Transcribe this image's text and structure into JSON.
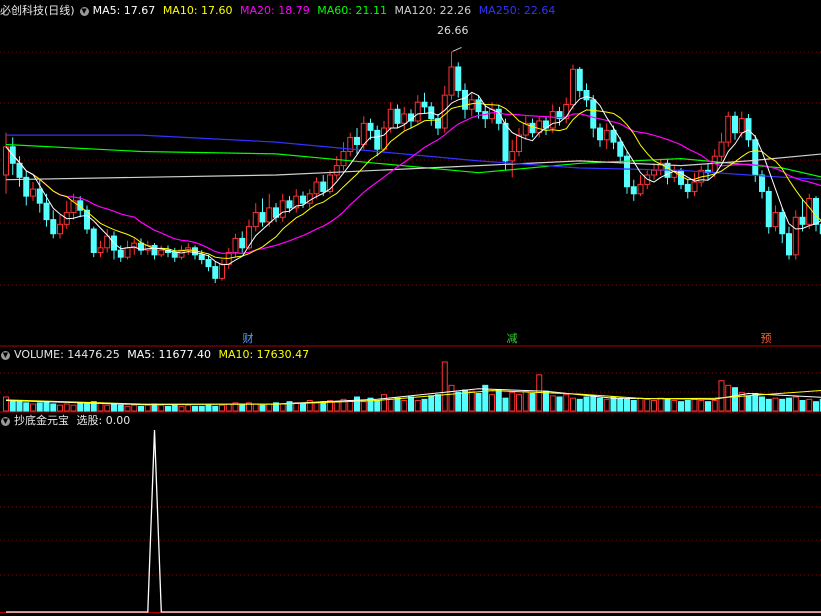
{
  "colors": {
    "up": "#ff3232",
    "down": "#54ffff",
    "ma5": "#ffffff",
    "ma10": "#ffff00",
    "ma20": "#ff00ff",
    "ma60": "#00ff00",
    "ma120": "#d0d0d0",
    "ma250": "#3232ff",
    "grid": "#8a0000",
    "sep": "#b00000",
    "axis": "#c00000"
  },
  "icons": {
    "menu": "circle-down-icon"
  },
  "price_panel": {
    "stock": "必创科技(日线)",
    "ma5": "MA5: 17.67",
    "ma10": "MA10: 17.60",
    "ma20": "MA20: 18.79",
    "ma60": "MA60: 21.11",
    "ma120": "MA120: 22.26",
    "ma250": "MA250: 22.64",
    "high_label": "26.66"
  },
  "markers": [
    {
      "text": "财",
      "color": "#54a0ff"
    },
    {
      "text": "减",
      "color": "#30d030"
    },
    {
      "text": "预",
      "color": "#ff6030"
    }
  ],
  "volume_panel": {
    "vol": "VOLUME: 14476.25",
    "ma5": "MA5: 11677.40",
    "ma10": "MA10: 17630.47"
  },
  "indicator_panel": {
    "name": "抄底金元宝",
    "value": "选股: 0.00"
  },
  "chart_data": [
    {
      "type": "candlestick",
      "title": "必创科技(日线)",
      "ylim": [
        14.8,
        28.0
      ],
      "annotations": [
        "26.66"
      ],
      "candles": [
        [
          21.4,
          22.6,
          20.6,
          23.2
        ],
        [
          22.6,
          21.9,
          21.4,
          23.0
        ],
        [
          21.9,
          21.3,
          20.9,
          22.2
        ],
        [
          21.3,
          20.5,
          20.1,
          21.6
        ],
        [
          20.5,
          20.8,
          20.3,
          21.1
        ],
        [
          20.8,
          20.2,
          19.8,
          21.2
        ],
        [
          20.2,
          19.5,
          19.2,
          20.6
        ],
        [
          19.5,
          18.9,
          18.7,
          19.9
        ],
        [
          18.9,
          19.3,
          18.7,
          19.7
        ],
        [
          19.3,
          19.8,
          19.1,
          20.3
        ],
        [
          19.8,
          20.3,
          19.5,
          20.6
        ],
        [
          20.3,
          19.9,
          19.6,
          20.5
        ],
        [
          19.9,
          19.1,
          18.9,
          20.1
        ],
        [
          19.1,
          18.1,
          17.9,
          19.2
        ],
        [
          18.1,
          18.3,
          17.9,
          18.6
        ],
        [
          18.3,
          18.8,
          18.1,
          19.1
        ],
        [
          18.8,
          18.2,
          17.8,
          19.0
        ],
        [
          18.2,
          17.9,
          17.7,
          18.4
        ],
        [
          17.9,
          18.3,
          17.8,
          18.6
        ],
        [
          18.3,
          18.5,
          18.0,
          18.7
        ],
        [
          18.5,
          18.2,
          18.0,
          18.7
        ],
        [
          18.2,
          18.4,
          18.0,
          18.6
        ],
        [
          18.4,
          18.0,
          17.8,
          18.5
        ],
        [
          18.0,
          18.2,
          17.9,
          18.4
        ],
        [
          18.2,
          18.1,
          17.9,
          18.4
        ],
        [
          18.1,
          17.9,
          17.7,
          18.3
        ],
        [
          17.9,
          18.2,
          17.8,
          18.4
        ],
        [
          18.2,
          18.3,
          18.0,
          18.5
        ],
        [
          18.3,
          18.0,
          17.8,
          18.4
        ],
        [
          18.0,
          17.8,
          17.6,
          18.2
        ],
        [
          17.8,
          17.5,
          17.3,
          18.0
        ],
        [
          17.5,
          17.0,
          16.8,
          17.7
        ],
        [
          17.0,
          17.6,
          16.9,
          17.8
        ],
        [
          17.6,
          18.1,
          17.4,
          18.3
        ],
        [
          18.1,
          18.7,
          17.9,
          18.9
        ],
        [
          18.7,
          18.3,
          18.1,
          19.0
        ],
        [
          18.3,
          19.2,
          18.2,
          19.5
        ],
        [
          19.2,
          19.8,
          19.0,
          20.2
        ],
        [
          19.8,
          19.4,
          19.2,
          20.4
        ],
        [
          19.4,
          20.0,
          19.2,
          20.6
        ],
        [
          20.0,
          19.6,
          19.4,
          20.2
        ],
        [
          19.6,
          20.3,
          19.4,
          20.6
        ],
        [
          20.3,
          20.0,
          19.8,
          20.5
        ],
        [
          20.0,
          20.5,
          19.8,
          20.8
        ],
        [
          20.5,
          20.2,
          20.0,
          20.7
        ],
        [
          20.2,
          20.6,
          20.0,
          20.8
        ],
        [
          20.6,
          21.1,
          20.4,
          21.3
        ],
        [
          21.1,
          20.7,
          20.5,
          21.4
        ],
        [
          20.7,
          21.4,
          20.6,
          21.6
        ],
        [
          21.4,
          21.8,
          21.2,
          22.2
        ],
        [
          21.8,
          22.4,
          21.6,
          22.8
        ],
        [
          22.4,
          23.0,
          22.2,
          23.2
        ],
        [
          23.0,
          22.7,
          22.3,
          23.4
        ],
        [
          22.7,
          23.6,
          22.5,
          23.9
        ],
        [
          23.6,
          23.3,
          22.9,
          23.8
        ],
        [
          23.3,
          22.5,
          22.2,
          23.5
        ],
        [
          22.5,
          23.4,
          22.4,
          23.7
        ],
        [
          23.4,
          24.2,
          23.2,
          24.5
        ],
        [
          24.2,
          23.6,
          23.4,
          24.4
        ],
        [
          23.6,
          24.0,
          23.3,
          24.3
        ],
        [
          24.0,
          23.7,
          23.4,
          24.2
        ],
        [
          23.7,
          24.5,
          23.6,
          24.8
        ],
        [
          24.5,
          24.3,
          24.0,
          24.9
        ],
        [
          24.3,
          23.8,
          23.5,
          24.5
        ],
        [
          23.8,
          23.4,
          23.1,
          24.0
        ],
        [
          23.4,
          24.8,
          23.2,
          25.2
        ],
        [
          24.8,
          26.0,
          24.6,
          26.66
        ],
        [
          26.0,
          25.0,
          24.7,
          26.2
        ],
        [
          25.0,
          24.2,
          23.8,
          25.3
        ],
        [
          24.2,
          24.6,
          23.9,
          24.9
        ],
        [
          24.6,
          24.1,
          23.8,
          24.8
        ],
        [
          24.1,
          23.8,
          23.4,
          24.4
        ],
        [
          23.8,
          24.2,
          23.6,
          24.5
        ],
        [
          24.2,
          23.6,
          23.3,
          24.4
        ],
        [
          23.6,
          22.0,
          21.6,
          23.8
        ],
        [
          22.0,
          22.4,
          21.3,
          22.9
        ],
        [
          22.4,
          23.1,
          22.2,
          23.4
        ],
        [
          23.1,
          23.6,
          22.9,
          23.9
        ],
        [
          23.6,
          23.2,
          23.0,
          23.8
        ],
        [
          23.2,
          23.7,
          23.0,
          23.9
        ],
        [
          23.7,
          23.4,
          23.1,
          23.9
        ],
        [
          23.4,
          24.1,
          23.2,
          24.4
        ],
        [
          24.1,
          23.8,
          23.5,
          24.3
        ],
        [
          23.8,
          24.4,
          23.6,
          24.7
        ],
        [
          24.4,
          25.9,
          24.2,
          26.1
        ],
        [
          25.9,
          25.0,
          24.7,
          26.0
        ],
        [
          25.0,
          24.6,
          24.3,
          25.3
        ],
        [
          24.6,
          23.4,
          23.0,
          24.8
        ],
        [
          23.4,
          22.9,
          22.6,
          23.6
        ],
        [
          22.9,
          23.3,
          22.5,
          23.6
        ],
        [
          23.3,
          22.8,
          22.5,
          23.5
        ],
        [
          22.8,
          22.2,
          21.9,
          23.0
        ],
        [
          22.2,
          20.9,
          20.6,
          22.4
        ],
        [
          20.9,
          20.6,
          20.3,
          21.2
        ],
        [
          20.6,
          21.0,
          20.5,
          21.4
        ],
        [
          21.0,
          21.4,
          20.8,
          21.6
        ],
        [
          21.4,
          21.6,
          21.2,
          21.9
        ],
        [
          21.6,
          21.9,
          21.4,
          22.1
        ],
        [
          21.9,
          21.3,
          21.0,
          22.1
        ],
        [
          21.3,
          21.6,
          21.1,
          21.8
        ],
        [
          21.6,
          21.0,
          20.8,
          21.7
        ],
        [
          21.0,
          20.7,
          20.4,
          21.2
        ],
        [
          20.7,
          21.1,
          20.5,
          21.5
        ],
        [
          21.1,
          21.6,
          20.9,
          21.8
        ],
        [
          21.6,
          21.5,
          21.2,
          21.9
        ],
        [
          21.5,
          22.2,
          21.3,
          22.5
        ],
        [
          22.2,
          22.8,
          22.0,
          23.2
        ],
        [
          22.8,
          23.9,
          22.6,
          24.1
        ],
        [
          23.9,
          23.2,
          22.9,
          24.1
        ],
        [
          23.2,
          23.8,
          23.0,
          24.1
        ],
        [
          23.8,
          22.9,
          22.6,
          24.0
        ],
        [
          22.9,
          21.4,
          21.1,
          23.1
        ],
        [
          21.4,
          20.7,
          20.4,
          21.6
        ],
        [
          20.7,
          19.2,
          18.9,
          20.9
        ],
        [
          19.2,
          19.8,
          19.0,
          20.1
        ],
        [
          19.8,
          18.9,
          18.5,
          20.0
        ],
        [
          18.9,
          18.0,
          17.8,
          19.2
        ],
        [
          18.0,
          19.6,
          17.8,
          19.9
        ],
        [
          19.6,
          19.3,
          19.0,
          20.4
        ],
        [
          19.3,
          20.4,
          19.1,
          20.6
        ],
        [
          20.4,
          19.3,
          19.0,
          20.5
        ],
        [
          19.3,
          18.9,
          18.7,
          19.5
        ]
      ],
      "ma_lines": [
        {
          "name": "MA60",
          "values": [
            [
              0,
              22.7
            ],
            [
              20,
              22.4
            ],
            [
              40,
              22.3
            ],
            [
              55,
              21.9
            ],
            [
              70,
              21.5
            ],
            [
              85,
              21.9
            ],
            [
              100,
              22.1
            ],
            [
              115,
              21.7
            ],
            [
              121,
              21.3
            ]
          ]
        },
        {
          "name": "MA120",
          "values": [
            [
              0,
              21.2
            ],
            [
              20,
              21.3
            ],
            [
              40,
              21.4
            ],
            [
              55,
              21.6
            ],
            [
              70,
              21.8
            ],
            [
              85,
              22.0
            ],
            [
              100,
              21.8
            ],
            [
              110,
              22.0
            ],
            [
              121,
              22.3
            ]
          ]
        },
        {
          "name": "MA250",
          "values": [
            [
              0,
              23.1
            ],
            [
              20,
              23.1
            ],
            [
              40,
              22.8
            ],
            [
              55,
              22.4
            ],
            [
              70,
              22.0
            ],
            [
              85,
              21.7
            ],
            [
              100,
              21.6
            ],
            [
              110,
              21.4
            ],
            [
              121,
              21.2
            ]
          ]
        }
      ]
    },
    {
      "type": "bar",
      "title": "VOLUME",
      "ylim": [
        0,
        42000
      ],
      "values": [
        12000,
        9000,
        8000,
        7000,
        6000,
        7000,
        8000,
        6000,
        5000,
        6000,
        5000,
        7000,
        6000,
        8000,
        7000,
        5000,
        6000,
        5000,
        4000,
        5000,
        4000,
        5000,
        6000,
        5000,
        4000,
        5000,
        4000,
        5000,
        4000,
        4000,
        5000,
        4000,
        5000,
        6000,
        7000,
        6000,
        7000,
        6000,
        5000,
        6000,
        7000,
        6000,
        8000,
        7000,
        6000,
        9000,
        7000,
        8000,
        9000,
        8000,
        10000,
        9000,
        12000,
        8000,
        11000,
        9000,
        14000,
        10000,
        11000,
        9000,
        12000,
        9000,
        10000,
        13000,
        14000,
        42000,
        22000,
        16000,
        18000,
        17000,
        15000,
        22000,
        14000,
        18000,
        11000,
        16000,
        14000,
        17000,
        15000,
        31000,
        17000,
        13000,
        12000,
        14000,
        11000,
        10000,
        12000,
        13000,
        11000,
        10000,
        12000,
        11000,
        10000,
        9000,
        11000,
        10000,
        9000,
        11000,
        10000,
        9000,
        8000,
        9000,
        10000,
        9000,
        8000,
        9000,
        26000,
        22000,
        20000,
        16000,
        13000,
        15000,
        12000,
        10000,
        11000,
        10000,
        11000,
        12000,
        9000,
        10000,
        8000,
        10000
      ],
      "ma_lines": [
        {
          "name": "MA5",
          "values": [
            [
              0,
              9000
            ],
            [
              20,
              5500
            ],
            [
              40,
              6000
            ],
            [
              55,
              10000
            ],
            [
              65,
              16000
            ],
            [
              70,
              19000
            ],
            [
              80,
              17000
            ],
            [
              90,
              11000
            ],
            [
              105,
              10000
            ],
            [
              110,
              15000
            ],
            [
              121,
              11677
            ]
          ]
        },
        {
          "name": "MA10",
          "values": [
            [
              0,
              9500
            ],
            [
              20,
              6000
            ],
            [
              40,
              5800
            ],
            [
              55,
              9000
            ],
            [
              65,
              14000
            ],
            [
              72,
              17500
            ],
            [
              85,
              14500
            ],
            [
              95,
              10500
            ],
            [
              105,
              11000
            ],
            [
              112,
              14000
            ],
            [
              121,
              17630
            ]
          ]
        }
      ]
    },
    {
      "type": "line",
      "title": "抄底金元宝",
      "ylim": [
        0,
        1
      ],
      "series": [
        {
          "name": "选股",
          "values": [
            [
              0,
              0
            ],
            [
              21,
              0
            ],
            [
              22,
              1
            ],
            [
              23,
              0
            ],
            [
              121,
              0
            ]
          ]
        }
      ]
    }
  ]
}
